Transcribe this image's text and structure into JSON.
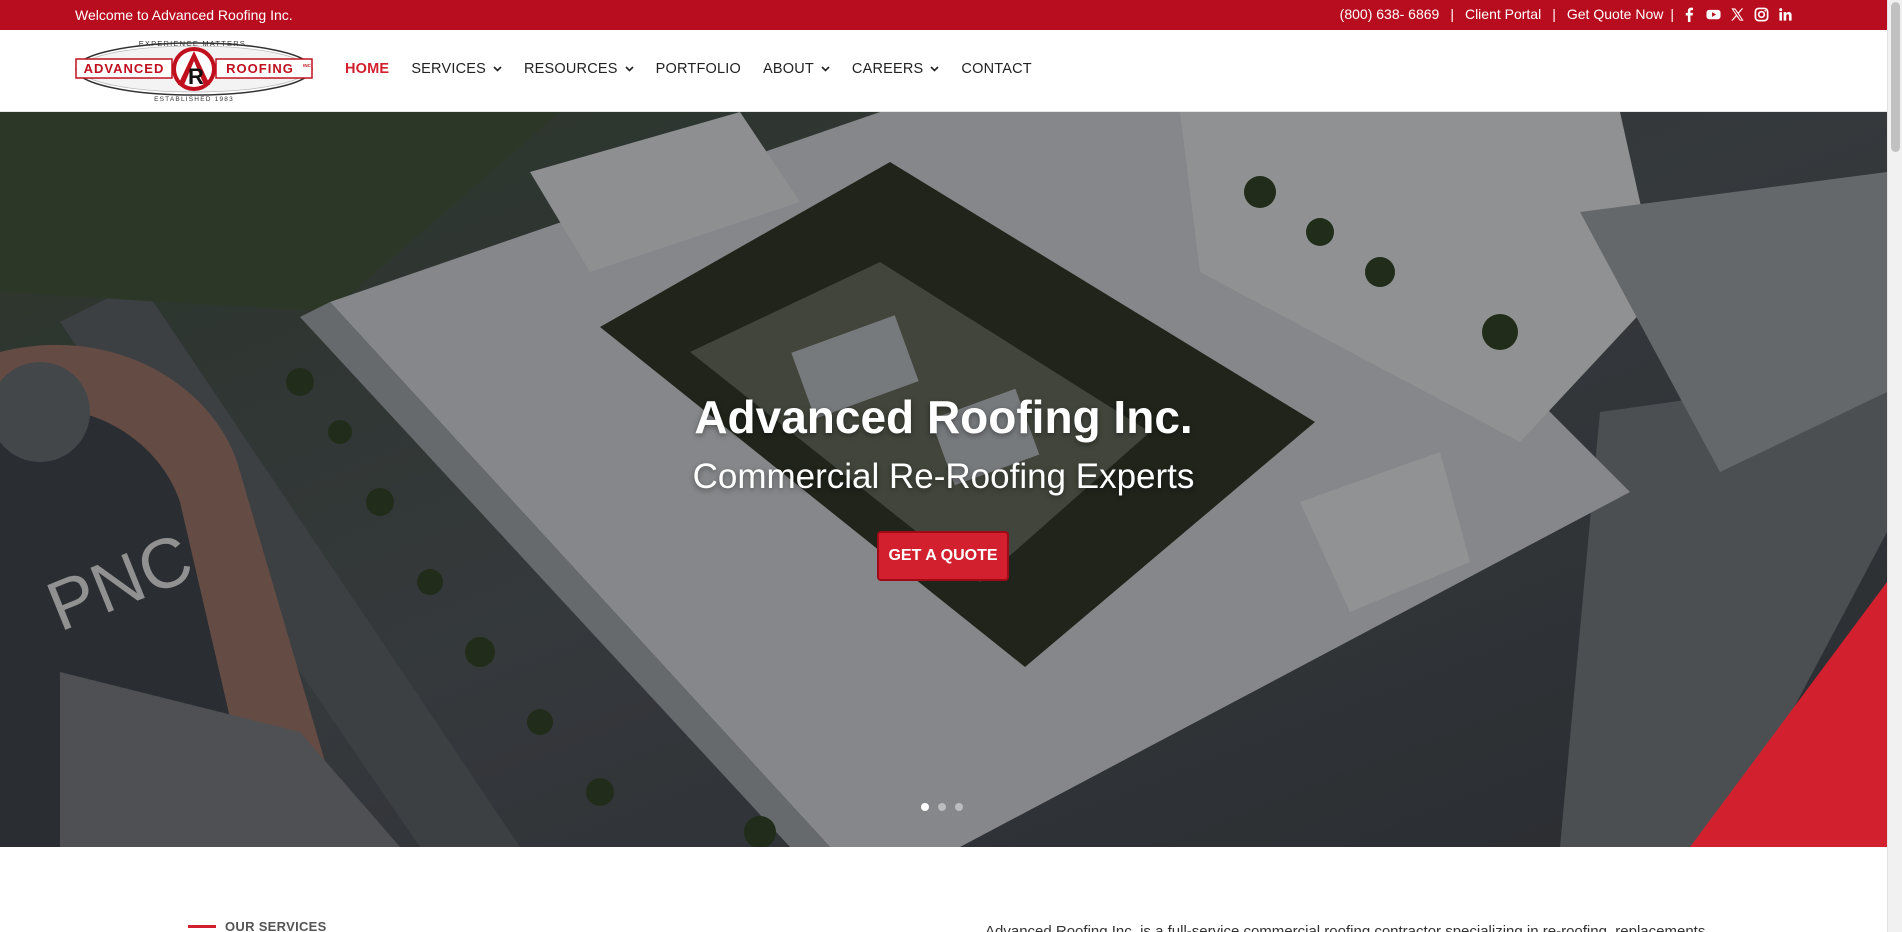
{
  "topbar": {
    "welcome": "Welcome to Advanced Roofing Inc.",
    "phone": "(800) 638- 6869",
    "separator": "|",
    "client_portal": "Client Portal",
    "get_quote": "Get Quote Now",
    "social_icons": [
      "facebook-icon",
      "youtube-icon",
      "x-icon",
      "instagram-icon",
      "linkedin-icon"
    ],
    "color": "#b80d1e"
  },
  "logo": {
    "tagline": "EXPERIENCE MATTERS.",
    "left_word": "ADVANCED",
    "right_word": "ROOFING",
    "inc": "INC",
    "monogram": "AR",
    "established": "ESTABLISHED 1983"
  },
  "nav": {
    "home": "HOME",
    "services": "SERVICES",
    "resources": "RESOURCES",
    "portfolio": "PORTFOLIO",
    "about": "ABOUT",
    "careers": "CAREERS",
    "contact": "CONTACT",
    "active_color": "#d2202f"
  },
  "hero": {
    "title": "Advanced Roofing Inc.",
    "subtitle": "Commercial Re-Roofing Experts",
    "cta": "GET A QUOTE",
    "building_sign": "PNC",
    "slides": 3,
    "active_slide": 1,
    "accent": "#d2202f"
  },
  "below": {
    "section_label": "OUR SERVICES",
    "intro_text": "Advanced Roofing Inc. is a full-service commercial roofing contractor specializing in re-roofing, replacements"
  }
}
